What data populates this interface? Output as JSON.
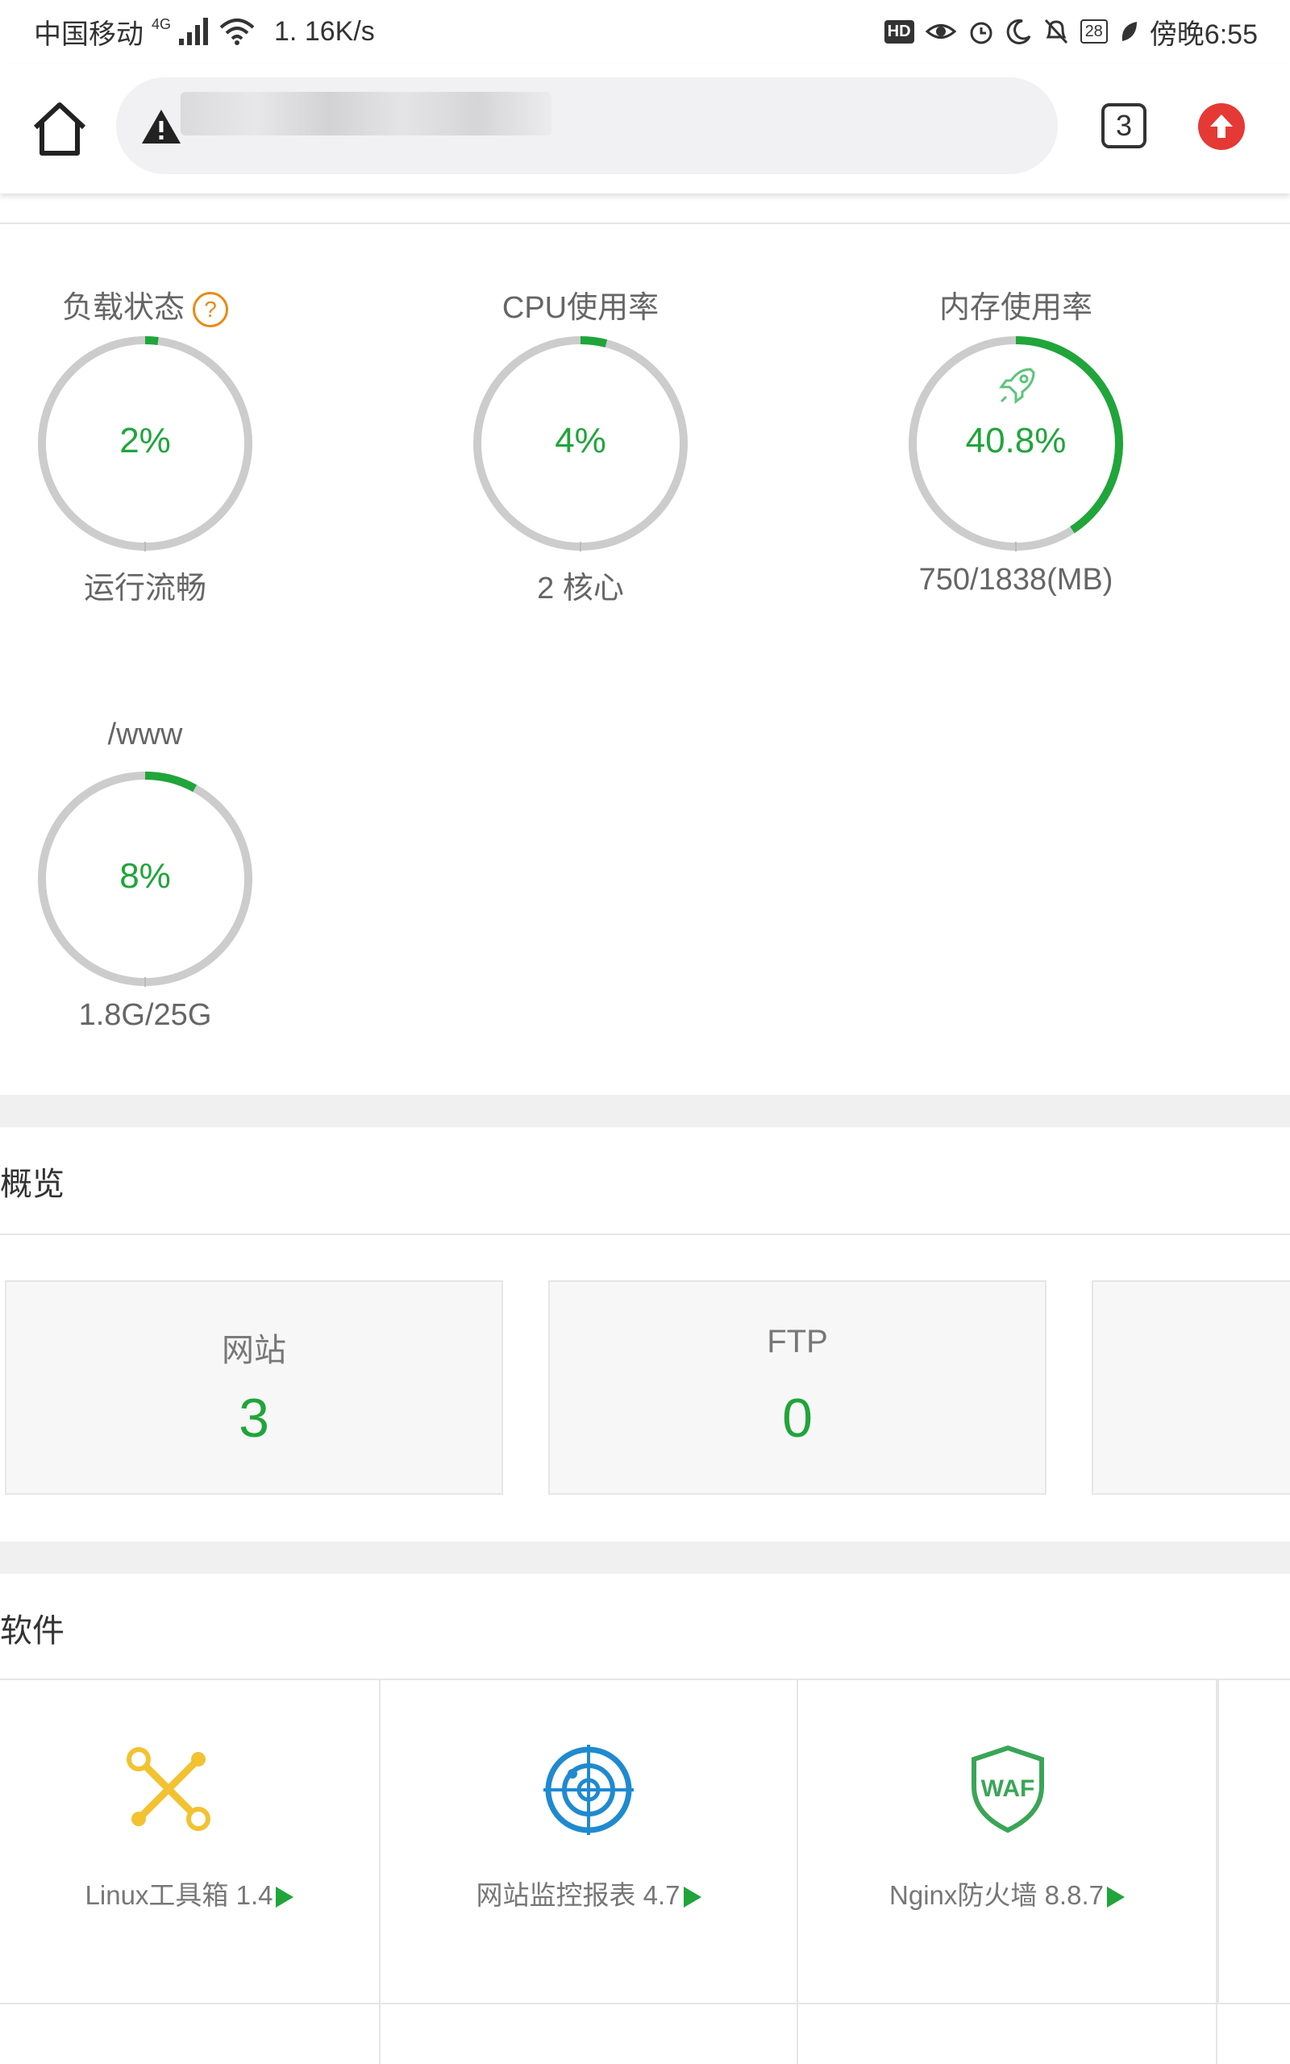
{
  "status_bar": {
    "carrier": "中国移动",
    "network": "4G",
    "speed": "1. 16K/s",
    "hd": "HD",
    "battery": "28",
    "time": "傍晚6:55"
  },
  "toolbar": {
    "tab_count": "3"
  },
  "gauges": [
    {
      "title": "负载状态",
      "value": "2%",
      "sub": "运行流畅",
      "percent": 2
    },
    {
      "title": "CPU使用率",
      "value": "4%",
      "sub": "2 核心",
      "percent": 4
    },
    {
      "title": "内存使用率",
      "value": "40.8%",
      "sub": "750/1838(MB)",
      "percent": 40.8
    },
    {
      "title": "/www",
      "value": "8%",
      "sub": "1.8G/25G",
      "percent": 8
    }
  ],
  "overview": {
    "title": "概览",
    "cards": [
      {
        "label": "网站",
        "value": "3"
      },
      {
        "label": "FTP",
        "value": "0"
      }
    ]
  },
  "software": {
    "title": "软件",
    "items": [
      {
        "label": "Linux工具箱 1.4"
      },
      {
        "label": "网站监控报表 4.7"
      },
      {
        "label": "Nginx防火墙 8.8.7"
      }
    ]
  },
  "colors": {
    "accent": "#20a53a",
    "track": "#cccccc",
    "help": "#e88a16",
    "update": "#e53935"
  }
}
